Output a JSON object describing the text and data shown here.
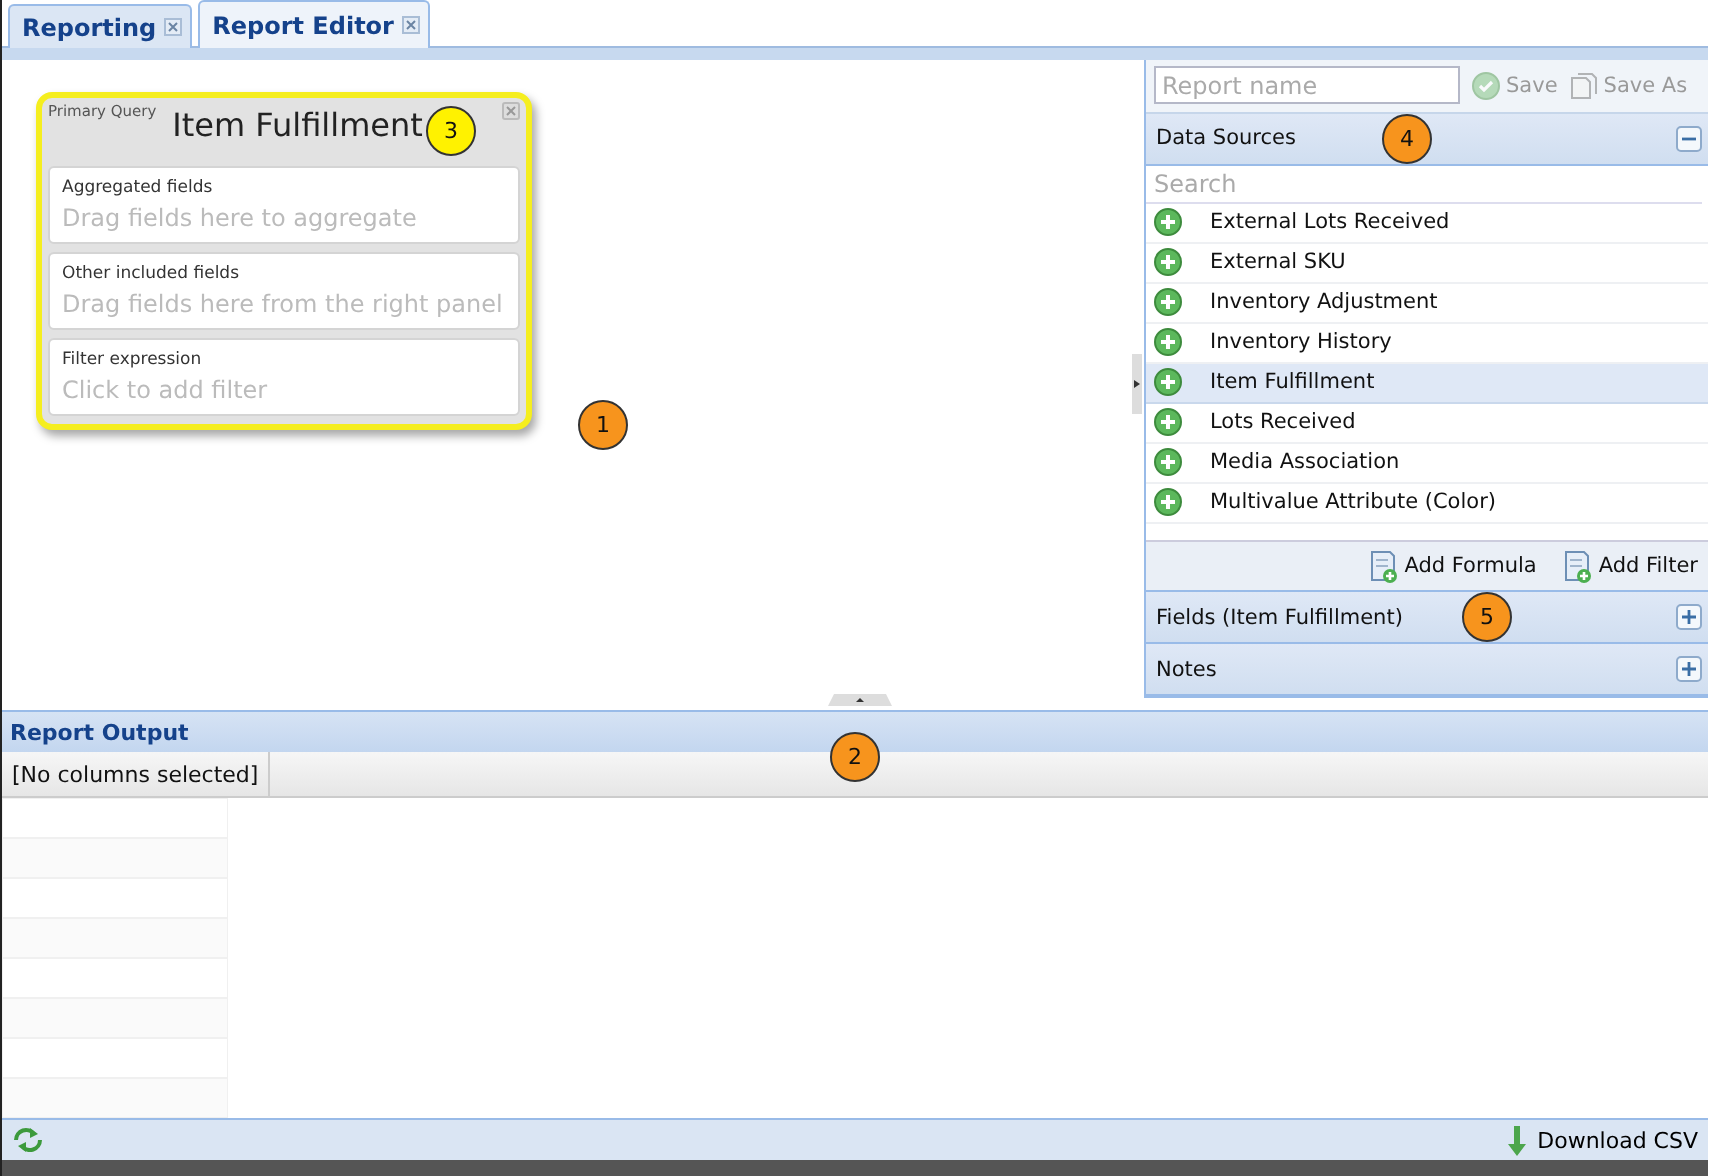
{
  "tabs": [
    {
      "label": "Reporting",
      "selected": false
    },
    {
      "label": "Report Editor",
      "selected": true
    }
  ],
  "query_card": {
    "caption": "Primary Query",
    "title": "Item Fulfillment",
    "sections": [
      {
        "label": "Aggregated fields",
        "placeholder": "Drag fields here to aggregate"
      },
      {
        "label": "Other included fields",
        "placeholder": "Drag fields here from the right panel"
      },
      {
        "label": "Filter expression",
        "placeholder": "Click to add filter"
      }
    ]
  },
  "side_panel": {
    "report_name": {
      "placeholder": "Report name"
    },
    "actions": [
      {
        "label": "Save",
        "disabled": true
      },
      {
        "label": "Save As",
        "disabled": true
      }
    ],
    "data_sources": {
      "title": "Data Sources",
      "expanded": true,
      "search": {
        "placeholder": "Search"
      },
      "items": [
        {
          "label": "External Lots Received",
          "selected": false
        },
        {
          "label": "External SKU",
          "selected": false
        },
        {
          "label": "Inventory Adjustment",
          "selected": false
        },
        {
          "label": "Inventory History",
          "selected": false
        },
        {
          "label": "Item Fulfillment",
          "selected": true
        },
        {
          "label": "Lots Received",
          "selected": false
        },
        {
          "label": "Media Association",
          "selected": false
        },
        {
          "label": "Multivalue Attribute (Color)",
          "selected": false
        }
      ]
    },
    "tools": [
      "Add Formula",
      "Add Filter"
    ],
    "sections": [
      {
        "title": "Fields (Item Fulfillment)",
        "expanded": false
      },
      {
        "title": "Notes",
        "expanded": false
      }
    ]
  },
  "report_output": {
    "title": "Report Output",
    "columns": [
      "[No columns selected]"
    ]
  },
  "footer": {
    "download": "Download CSV"
  },
  "callouts": [
    {
      "label": "1",
      "color": "#f7941d"
    },
    {
      "label": "2",
      "color": "#f7941d"
    },
    {
      "label": "3",
      "color": "#fff200"
    },
    {
      "label": "4",
      "color": "#f7941d"
    },
    {
      "label": "5",
      "color": "#f7941d"
    }
  ]
}
